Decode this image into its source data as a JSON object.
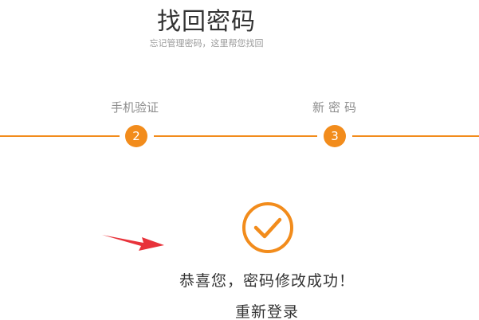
{
  "header": {
    "title": "找回密码",
    "subtitle": "忘记管理密码，这里帮您找回"
  },
  "steps": [
    {
      "number": "2",
      "label": "手机验证"
    },
    {
      "number": "3",
      "label": "新密码"
    }
  ],
  "result": {
    "message": "恭喜您，密码修改成功！",
    "relogin_label": "重新登录"
  },
  "colors": {
    "accent": "#f28c1c",
    "annotation_arrow": "#e8323a"
  },
  "icons": {
    "success": "check-circle-icon",
    "annotation": "red-arrow-icon"
  }
}
